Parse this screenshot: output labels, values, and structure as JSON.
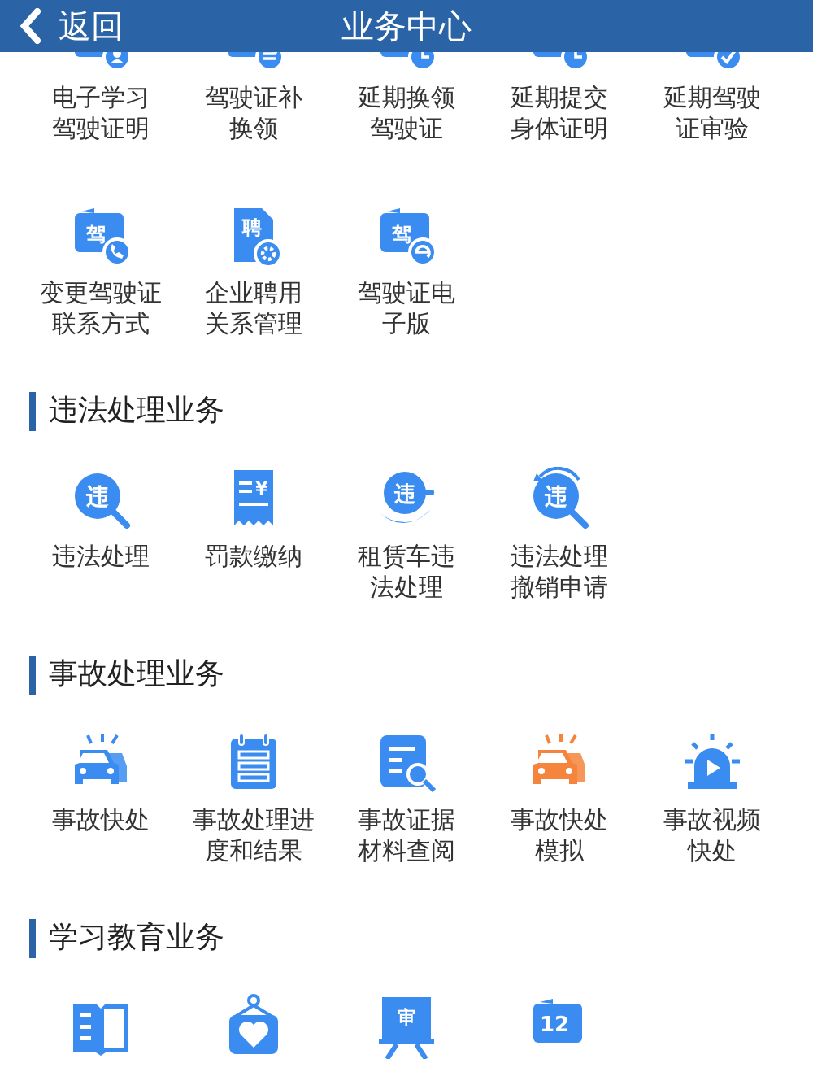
{
  "header": {
    "back": "返回",
    "title": "业务中心"
  },
  "sections": [
    {
      "items": [
        {
          "label": [
            "电子学习",
            "驾驶证明"
          ],
          "kind": "card-person",
          "color": "#3a8cf0"
        },
        {
          "label": [
            "驾驶证补",
            "换领"
          ],
          "kind": "card-swap",
          "color": "#3a8cf0"
        },
        {
          "label": [
            "延期换领",
            "驾驶证"
          ],
          "kind": "card-clock",
          "color": "#3a8cf0"
        },
        {
          "label": [
            "延期提交",
            "身体证明"
          ],
          "kind": "card-clock",
          "color": "#3a8cf0"
        },
        {
          "label": [
            "延期驾驶",
            "证审验"
          ],
          "kind": "card-check",
          "color": "#3a8cf0"
        },
        {
          "label": [
            "变更驾驶证",
            "联系方式"
          ],
          "kind": "card-phone",
          "badge": "驾",
          "color": "#3a8cf0"
        },
        {
          "label": [
            "企业聘用",
            "关系管理"
          ],
          "kind": "doc-gear",
          "badge": "聘",
          "color": "#3a8cf0"
        },
        {
          "label": [
            "驾驶证电",
            "子版"
          ],
          "kind": "card-e",
          "badge": "驾",
          "color": "#3a8cf0"
        }
      ]
    },
    {
      "title": "违法处理业务",
      "items": [
        {
          "label": [
            "违法处理"
          ],
          "kind": "magnifier",
          "badge": "违",
          "color": "#3a8cf0"
        },
        {
          "label": [
            "罚款缴纳"
          ],
          "kind": "receipt",
          "badge": "¥",
          "color": "#3a8cf0"
        },
        {
          "label": [
            "租赁车违",
            "法处理"
          ],
          "kind": "hand",
          "badge": "违",
          "color": "#3a8cf0"
        },
        {
          "label": [
            "违法处理",
            "撤销申请"
          ],
          "kind": "undo-magnifier",
          "badge": "违",
          "color": "#3a8cf0"
        }
      ]
    },
    {
      "title": "事故处理业务",
      "items": [
        {
          "label": [
            "事故快处"
          ],
          "kind": "cars",
          "color": "#3a8cf0"
        },
        {
          "label": [
            "事故处理进",
            "度和结果"
          ],
          "kind": "calendar",
          "color": "#3a8cf0"
        },
        {
          "label": [
            "事故证据",
            "材料查阅"
          ],
          "kind": "doc-search",
          "color": "#3a8cf0"
        },
        {
          "label": [
            "事故快处",
            "模拟"
          ],
          "kind": "cars",
          "color": "#f5843c"
        },
        {
          "label": [
            "事故视频",
            "快处"
          ],
          "kind": "siren",
          "color": "#3a8cf0"
        }
      ]
    },
    {
      "title": "学习教育业务",
      "items": [
        {
          "kind": "book",
          "color": "#3a8cf0"
        },
        {
          "kind": "sign",
          "color": "#3a8cf0"
        },
        {
          "kind": "board",
          "badge": "审",
          "color": "#3a8cf0"
        },
        {
          "kind": "card-plain",
          "badge": "12",
          "color": "#3a8cf0"
        }
      ]
    }
  ]
}
